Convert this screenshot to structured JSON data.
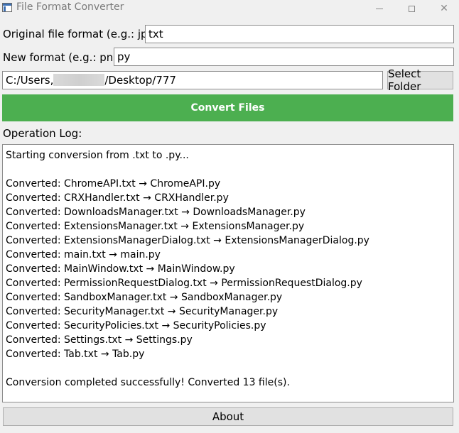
{
  "window": {
    "title": "File Format Converter",
    "minimize_glyph": "",
    "maximize_glyph": "",
    "close_glyph": "✕"
  },
  "form": {
    "original_label": "Original file format (e.g.: jpg):",
    "original_value": "txt",
    "new_label": "New format (e.g.: png):",
    "new_value": "py",
    "path_prefix": "C:/Users,",
    "path_suffix": "/Desktop/777",
    "select_folder_label": "Select Folder",
    "convert_label": "Convert Files"
  },
  "log": {
    "label": "Operation Log:",
    "lines": [
      "Starting conversion from .txt to .py...",
      "",
      "Converted: ChromeAPI.txt → ChromeAPI.py",
      "Converted: CRXHandler.txt → CRXHandler.py",
      "Converted: DownloadsManager.txt → DownloadsManager.py",
      "Converted: ExtensionsManager.txt → ExtensionsManager.py",
      "Converted: ExtensionsManagerDialog.txt → ExtensionsManagerDialog.py",
      "Converted: main.txt → main.py",
      "Converted: MainWindow.txt → MainWindow.py",
      "Converted: PermissionRequestDialog.txt → PermissionRequestDialog.py",
      "Converted: SandboxManager.txt → SandboxManager.py",
      "Converted: SecurityManager.txt → SecurityManager.py",
      "Converted: SecurityPolicies.txt → SecurityPolicies.py",
      "Converted: Settings.txt → Settings.py",
      "Converted: Tab.txt → Tab.py",
      "",
      "Conversion completed successfully! Converted 13 file(s)."
    ]
  },
  "about_label": "About",
  "colors": {
    "convert_button": "#4caf50",
    "window_background": "#f0f0f0"
  }
}
